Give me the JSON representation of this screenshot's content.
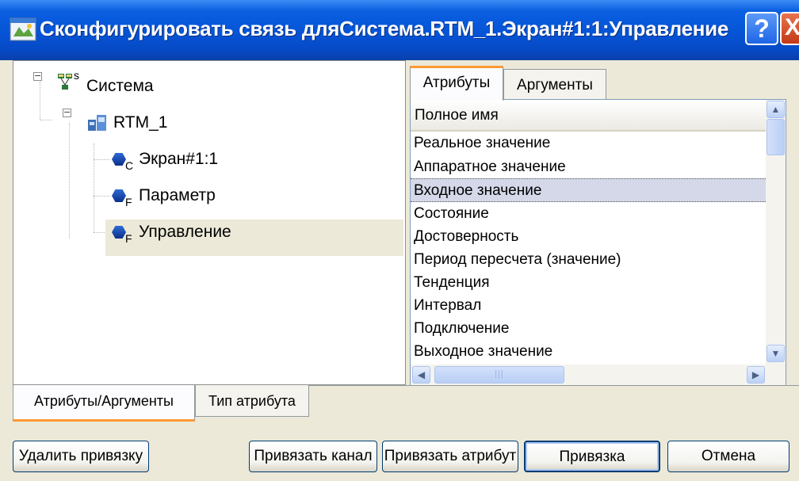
{
  "window": {
    "title": "Сконфигурировать связь дляСистема.RTM_1.Экран#1:1:Управление",
    "help_glyph": "?",
    "close_glyph": "X"
  },
  "tree": {
    "root": {
      "label": "Система",
      "expander": "−",
      "icon": "system-network-icon",
      "icon_superscript": "s"
    },
    "rtm": {
      "label": "RTM_1",
      "expander": "−",
      "icon": "rtm-workstation-icon"
    },
    "children": [
      {
        "label": "Экран#1:1",
        "icon": "object-hexagon-icon",
        "subscript": "C"
      },
      {
        "label": "Параметр",
        "icon": "object-hexagon-icon",
        "subscript": "F"
      },
      {
        "label": "Управление",
        "icon": "object-hexagon-icon",
        "subscript": "F",
        "selected": true
      }
    ]
  },
  "right_tabs": [
    {
      "label": "Атрибуты",
      "active": true
    },
    {
      "label": "Аргументы",
      "active": false
    }
  ],
  "list": {
    "header": "Полное имя",
    "rows": [
      "Реальное значение",
      "Аппаратное значение",
      "Входное значение",
      "Состояние",
      "Достоверность",
      "Период пересчета (значение)",
      "Тенденция",
      "Интервал",
      "Подключение",
      "Выходное значение"
    ],
    "selected_index": 2,
    "scroll_glyphs": {
      "up": "▲",
      "down": "▼",
      "left": "◀",
      "right": "▶",
      "grip": "|||"
    }
  },
  "bottom_tabs": [
    {
      "label": "Атрибуты/Аргументы",
      "active": true
    },
    {
      "label": "Тип атрибута",
      "active": false
    }
  ],
  "buttons": {
    "delete_binding": "Удалить привязку",
    "bind_channel": "Привязать канал",
    "bind_attribute": "Привязать атрибут",
    "binding": "Привязка",
    "cancel": "Отмена"
  },
  "colors": {
    "titlebar": "#0654d6",
    "dialog_bg": "#ece9d8",
    "tab_accent": "#ff9933",
    "selection": "#d4d8e8"
  }
}
